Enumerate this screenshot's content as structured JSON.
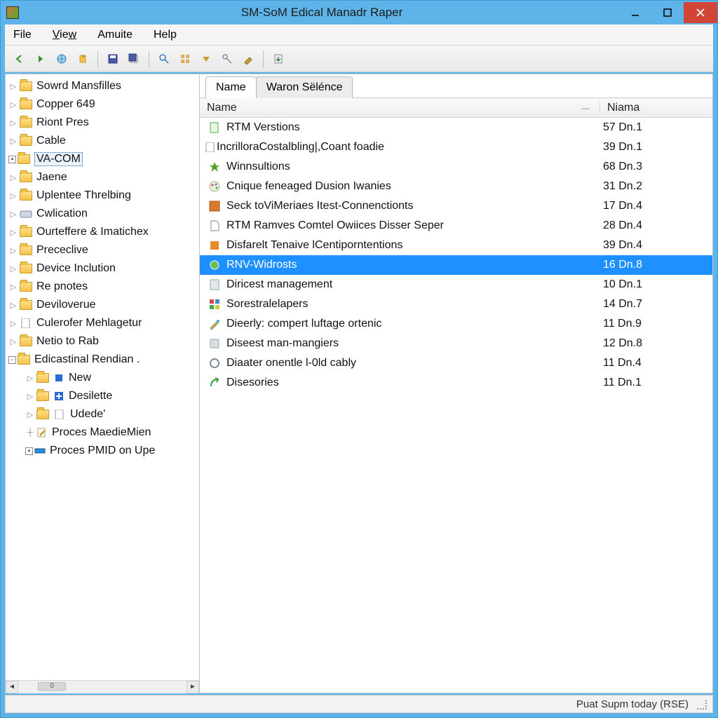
{
  "window": {
    "title": "SM-SoM Edical Manadr Raper"
  },
  "menu": {
    "file": "File",
    "view": "View",
    "amuite": "Amuite",
    "help": "Help"
  },
  "hscroll_label": "0",
  "tree": {
    "items": [
      {
        "label": "Sowrd Mansfilles",
        "icon": "folder",
        "exp": "tri"
      },
      {
        "label": "Copper 649",
        "icon": "folder",
        "exp": "tri"
      },
      {
        "label": "Riont Pres",
        "icon": "folder",
        "exp": "tri"
      },
      {
        "label": "Cable",
        "icon": "folder",
        "exp": "tri"
      },
      {
        "label": "VA-COM",
        "icon": "folder",
        "exp": "box",
        "selected": true
      },
      {
        "label": "Jaene",
        "icon": "folder",
        "exp": "tri"
      },
      {
        "label": "Uplentee Threlbing",
        "icon": "folder",
        "exp": "tri"
      },
      {
        "label": "Cwlication",
        "icon": "disk",
        "exp": "tri"
      },
      {
        "label": "Ourteffere & Imatichex",
        "icon": "folder",
        "exp": "tri"
      },
      {
        "label": "Prececlive",
        "icon": "folder",
        "exp": "tri"
      },
      {
        "label": "Device Inclution",
        "icon": "folder",
        "exp": "tri"
      },
      {
        "label": "Re pnotes",
        "icon": "folder",
        "exp": "tri"
      },
      {
        "label": "Deviloverue",
        "icon": "folder",
        "exp": "tri"
      },
      {
        "label": "Culerofer Mehlagetur",
        "icon": "doc",
        "exp": "tri"
      },
      {
        "label": "Netio to Rab",
        "icon": "folder",
        "exp": "tri"
      },
      {
        "label": "Edicastinal Rendian .",
        "icon": "folder",
        "exp": "box-open"
      }
    ],
    "children": [
      {
        "label": "New",
        "icon": "blue-cube"
      },
      {
        "label": "Desilette",
        "icon": "blue-plus"
      },
      {
        "label": "Udede'",
        "icon": "doc"
      }
    ],
    "tail": [
      {
        "label": "Proces MaedieMien",
        "icon": "edit",
        "exp": "plus"
      },
      {
        "label": "Proces PMID on Upe",
        "icon": "blue-bar",
        "exp": "box-dot"
      }
    ]
  },
  "tabs": {
    "name": "Name",
    "waron": "Waron Sëlénce"
  },
  "columns": {
    "name": "Name",
    "size": "Niama"
  },
  "rows": [
    {
      "name": "RTM Verstions",
      "size": "57 Dn.1",
      "icon": "green-doc"
    },
    {
      "name": "IncrilloraCostalbling|,Coant foadie",
      "size": "39 Dn.1",
      "icon": "doc"
    },
    {
      "name": "Winnsultions",
      "size": "68 Dn.3",
      "icon": "green-star"
    },
    {
      "name": "Cnique feneaged Dusion Iwanies",
      "size": "31 Dn.2",
      "icon": "palette"
    },
    {
      "name": "Seck toViMeriaes Itest-Connenctionts",
      "size": "17 Dn.4",
      "icon": "orange-box"
    },
    {
      "name": "RTM Ramves Comtel Owiices Disser Seper",
      "size": "28 Dn.4",
      "icon": "outline-doc"
    },
    {
      "name": "Disfarelt Tenaive lCentiporntentions",
      "size": "39 Dn.4",
      "icon": "orange-fill"
    },
    {
      "name": "RNV-Widrosts",
      "size": "16 Dn.8",
      "icon": "green-circle",
      "selected": true
    },
    {
      "name": "Diricest management",
      "size": "10 Dn.1",
      "icon": "grey-doc"
    },
    {
      "name": "Sorestralelapers",
      "size": "14 Dn.7",
      "icon": "color-grid"
    },
    {
      "name": "Dieerly: compert luftage ortenic",
      "size": "11 Dn.9",
      "icon": "brush"
    },
    {
      "name": "Diseest man-mangiers",
      "size": "12 Dn.8",
      "icon": "grey-box"
    },
    {
      "name": "Diaater onentle l-0ld cably",
      "size": "11 Dn.4",
      "icon": "ring"
    },
    {
      "name": "Disesories",
      "size": "11 Dn.1",
      "icon": "green-arrow"
    }
  ],
  "status": {
    "text": "Puat Supm today (RSE)"
  }
}
